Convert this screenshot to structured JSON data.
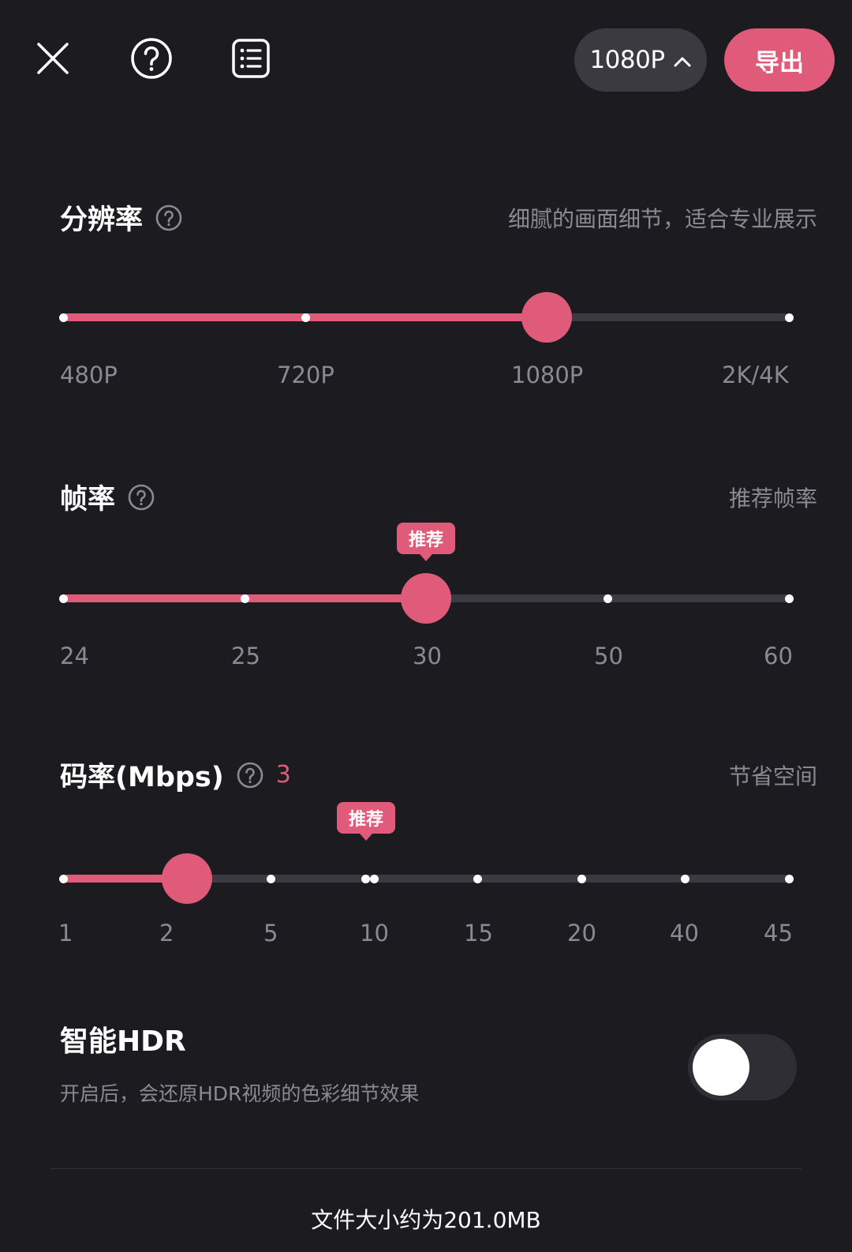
{
  "topbar": {
    "close_icon": "close-icon",
    "help_icon": "help-circle-icon",
    "list_icon": "list-icon",
    "resolution_label": "1080P",
    "export_label": "导出"
  },
  "colors": {
    "accent": "#e05b7a",
    "background": "#1b1b20",
    "track": "#3a3a40",
    "muted_text": "#8a8a90"
  },
  "resolution": {
    "title": "分辨率",
    "hint": "细腻的画面细节，适合专业展示",
    "labels": [
      "480P",
      "720P",
      "1080P",
      "2K/4K"
    ],
    "selected": "1080P"
  },
  "framerate": {
    "title": "帧率",
    "hint": "推荐帧率",
    "labels": [
      "24",
      "25",
      "30",
      "50",
      "60"
    ],
    "selected": "30",
    "recommended": "30",
    "recommended_label": "推荐"
  },
  "bitrate": {
    "title": "码率(Mbps)",
    "value": "3",
    "hint": "节省空间",
    "labels": [
      "1",
      "2",
      "5",
      "10",
      "15",
      "20",
      "40",
      "45"
    ],
    "selected_value": 3,
    "recommended_label": "推荐"
  },
  "hdr": {
    "title": "智能HDR",
    "description": "开启后，会还原HDR视频的色彩细节效果",
    "enabled": false
  },
  "footer": {
    "file_size": "文件大小约为201.0MB"
  }
}
